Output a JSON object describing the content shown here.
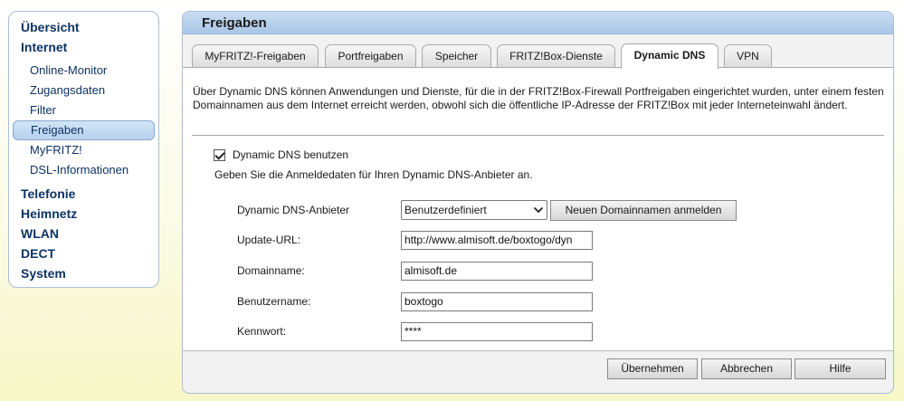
{
  "nav": {
    "main_top": [
      {
        "label": "Übersicht"
      },
      {
        "label": "Internet"
      }
    ],
    "internet_items": [
      {
        "label": "Online-Monitor"
      },
      {
        "label": "Zugangsdaten"
      },
      {
        "label": "Filter"
      },
      {
        "label": "Freigaben"
      },
      {
        "label": "MyFRITZ!"
      },
      {
        "label": "DSL-Informationen"
      }
    ],
    "main_bottom": [
      {
        "label": "Telefonie"
      },
      {
        "label": "Heimnetz"
      },
      {
        "label": "WLAN"
      },
      {
        "label": "DECT"
      },
      {
        "label": "System"
      }
    ]
  },
  "panel": {
    "title": "Freigaben",
    "tabs": [
      {
        "label": "MyFRITZ!-Freigaben"
      },
      {
        "label": "Portfreigaben"
      },
      {
        "label": "Speicher"
      },
      {
        "label": "FRITZ!Box-Dienste"
      },
      {
        "label": "Dynamic DNS"
      },
      {
        "label": "VPN"
      }
    ],
    "active_tab": "Dynamic DNS",
    "intro": "Über Dynamic DNS können Anwendungen und Dienste, für die in der FRITZ!Box-Firewall Portfreigaben eingerichtet wurden, unter einem festen Domainnamen aus dem Internet erreicht werden, obwohl sich die öffentliche IP-Adresse der FRITZ!Box mit jeder Interneteinwahl ändert.",
    "enable_label": "Dynamic DNS benutzen",
    "enable_checked": true,
    "hint": "Geben Sie die Anmeldedaten für Ihren Dynamic DNS-Anbieter an.",
    "form": {
      "provider_label": "Dynamic DNS-Anbieter",
      "provider_value": "Benutzerdefiniert",
      "register_button": "Neuen Domainnamen anmelden",
      "update_url_label": "Update-URL:",
      "update_url_value": "http://www.almisoft.de/boxtogo/dyn",
      "domain_label": "Domainname:",
      "domain_value": "almisoft.de",
      "user_label": "Benutzername:",
      "user_value": "boxtogo",
      "password_label": "Kennwort:",
      "password_value": "****"
    },
    "buttons": {
      "apply": "Übernehmen",
      "cancel": "Abbrechen",
      "help": "Hilfe"
    }
  }
}
